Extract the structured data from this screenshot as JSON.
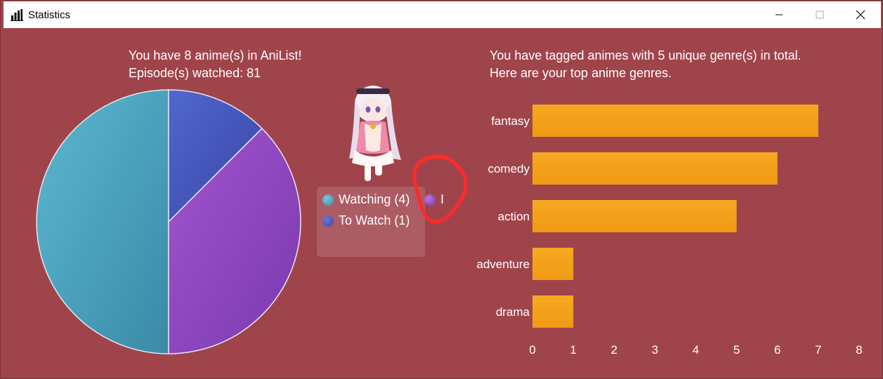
{
  "window": {
    "title": "Statistics",
    "title_icon": "bar-chart-icon",
    "controls": [
      "minimize-icon",
      "maximize-icon",
      "close-icon"
    ]
  },
  "left": {
    "heading_line1": "You have 8 anime(s) in AniList!",
    "heading_line2": "Episode(s) watched: 81"
  },
  "right": {
    "heading_line1": "You have tagged animes with 5 unique genre(s) in total.",
    "heading_line2": "Here are your top anime genres."
  },
  "legend": {
    "items": [
      {
        "label": "Watching (4)",
        "color": "#4aa3be"
      },
      {
        "label": "To Watch (1)",
        "color": "#4655b8"
      },
      {
        "label": "I",
        "color": "#8c44c0"
      }
    ]
  },
  "colors": {
    "background": "#a0444c",
    "bar": "#f5a11c",
    "annotation": "#ff2a2a"
  },
  "chart_data": [
    {
      "type": "pie",
      "categories": [
        "Watching",
        "To Watch",
        "I"
      ],
      "values": [
        4,
        1,
        3
      ],
      "colors": [
        "#4aa3be",
        "#4655b8",
        "#8c44c0"
      ]
    },
    {
      "type": "bar",
      "orientation": "horizontal",
      "categories": [
        "fantasy",
        "comedy",
        "action",
        "adventure",
        "drama"
      ],
      "values": [
        7,
        6,
        5,
        1,
        1
      ],
      "xlim": [
        0,
        8
      ],
      "xticks": [
        "0",
        "1",
        "2",
        "3",
        "4",
        "5",
        "6",
        "7",
        "8"
      ],
      "grid": false
    }
  ]
}
